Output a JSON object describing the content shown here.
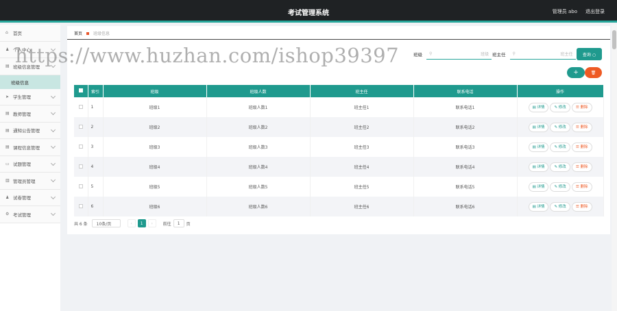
{
  "header": {
    "title": "考试管理系统",
    "user": "管理员 abo",
    "logout": "退出登录"
  },
  "sidebar": {
    "items": [
      {
        "label": "首页",
        "icon": "home-icon",
        "glyph": "⌂",
        "arrow": false
      },
      {
        "label": "个人中心",
        "icon": "user-icon",
        "glyph": "♟",
        "arrow": true
      },
      {
        "label": "班级信息管理",
        "icon": "doc-icon",
        "glyph": "▤",
        "arrow": true,
        "sub": "班级信息"
      },
      {
        "label": "学生管理",
        "icon": "send-icon",
        "glyph": "➤",
        "arrow": true
      },
      {
        "label": "教师管理",
        "icon": "list-icon",
        "glyph": "▤",
        "arrow": true
      },
      {
        "label": "通知公告管理",
        "icon": "list-icon",
        "glyph": "▤",
        "arrow": true
      },
      {
        "label": "课程信息管理",
        "icon": "list-icon",
        "glyph": "▤",
        "arrow": true
      },
      {
        "label": "试题管理",
        "icon": "chat-icon",
        "glyph": "▭",
        "arrow": true
      },
      {
        "label": "管理员管理",
        "icon": "bar-chart-icon",
        "glyph": "▥",
        "arrow": true
      },
      {
        "label": "试卷管理",
        "icon": "user-icon",
        "glyph": "♟",
        "arrow": true
      },
      {
        "label": "考试管理",
        "icon": "settings-icon",
        "glyph": "⚙",
        "arrow": true
      }
    ]
  },
  "breadcrumb": {
    "home": "首页",
    "current": "班级信息"
  },
  "search": {
    "class_label": "班级",
    "class_placeholder": "班级",
    "teacher_label": "班主任",
    "teacher_placeholder": "班主任",
    "query_button": "查询 ○"
  },
  "actions": {
    "add": "+",
    "delete": "🗑"
  },
  "table": {
    "columns": [
      "索引",
      "班级",
      "班级人数",
      "班主任",
      "联系电话",
      "操作"
    ],
    "rows": [
      {
        "index": "1",
        "class": "班级1",
        "count": "班级人数1",
        "teacher": "班主任1",
        "phone": "联系电话1"
      },
      {
        "index": "2",
        "class": "班级2",
        "count": "班级人数2",
        "teacher": "班主任2",
        "phone": "联系电话2"
      },
      {
        "index": "3",
        "class": "班级3",
        "count": "班级人数3",
        "teacher": "班主任3",
        "phone": "联系电话3"
      },
      {
        "index": "4",
        "class": "班级4",
        "count": "班级人数4",
        "teacher": "班主任4",
        "phone": "联系电话4"
      },
      {
        "index": "5",
        "class": "班级5",
        "count": "班级人数5",
        "teacher": "班主任5",
        "phone": "联系电话5"
      },
      {
        "index": "6",
        "class": "班级6",
        "count": "班级人数6",
        "teacher": "班主任6",
        "phone": "联系电话6"
      }
    ],
    "ops": {
      "detail": "▤ 详情",
      "edit": "✎ 修改",
      "delete": "☰ 删除"
    }
  },
  "pagination": {
    "total": "共 6 条",
    "page_size": "10条/页",
    "prev": "‹",
    "current": "1",
    "next": "›",
    "goto_label": "前往",
    "goto_value": "1",
    "page_unit": "页"
  },
  "watermark": "https://www.huzhan.com/ishop39397"
}
